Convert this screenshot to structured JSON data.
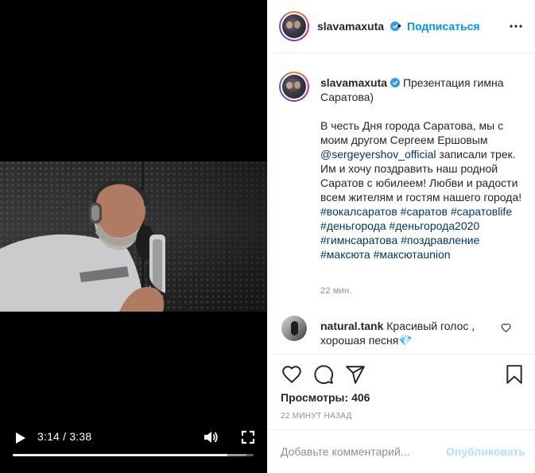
{
  "post": {
    "username": "slavamaxuta",
    "verified_icon": "verified-badge-icon",
    "follow_label": "Подписаться",
    "separator": "•",
    "caption": {
      "title": "Презентация гимна Саратова)",
      "body_line1": "В честь Дня города Саратова, мы с моим другом Сергеем Ершовым",
      "mention": "@sergeyershov_official",
      "body_line2": " записали трек. Им и хочу поздравить наш родной Саратов с юбилеем! Любви и радости всем жителям и гостям нашего города!",
      "hashtags": [
        "#вокалсаратов",
        "#саратов",
        "#саратовlife",
        "#деньгорода",
        "#деньгорода2020",
        "#гимнсаратова",
        "#поздравление",
        "#максюта",
        "#максютаunion"
      ],
      "time": "22 мин."
    },
    "comment": {
      "username": "natural.tank",
      "text": "Красивый голос , хорошая песня",
      "emoji": "💎"
    },
    "views_label": "Просмотры:",
    "views_count": "406",
    "date": "22 минут назад",
    "add_comment_placeholder": "Добавьте комментарий...",
    "publish_label": "Опубликовать"
  },
  "video": {
    "current_time": "3:14",
    "duration": "3:38",
    "time_display": "3:14 / 3:38",
    "progress_fraction": 0.89,
    "buffered_fraction": 0.97
  },
  "colors": {
    "accent": "#0095f6",
    "publish_disabled": "#b2dffc",
    "link": "#00376b",
    "muted": "#8e8e8e",
    "video_bg": "#000000"
  },
  "icons": [
    "play-icon",
    "volume-icon",
    "fullscreen-icon",
    "more-options-icon",
    "heart-icon",
    "comment-icon",
    "share-icon",
    "bookmark-icon",
    "verified-badge-icon"
  ]
}
